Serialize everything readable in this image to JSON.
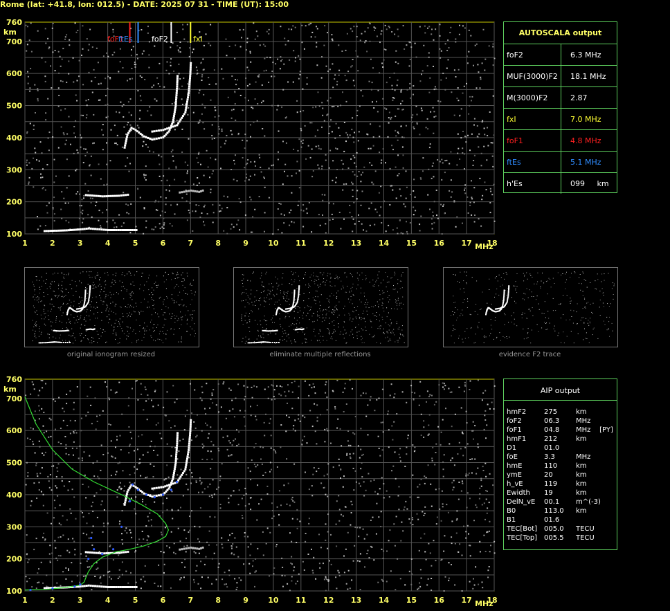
{
  "header": {
    "title": "Rome (lat: +41.8, lon: 012.5) - DATE: 2025 07 31 - TIME (UT): 15:00"
  },
  "autoscala": {
    "title": "AUTOSCALA output",
    "rows": [
      {
        "label": "foF2",
        "value": "6.3 MHz",
        "color": "#ffffff"
      },
      {
        "label": "MUF(3000)F2",
        "value": "18.1 MHz",
        "color": "#ffffff"
      },
      {
        "label": "M(3000)F2",
        "value": "2.87",
        "color": "#ffffff"
      },
      {
        "label": "fxI",
        "value": "7.0 MHz",
        "color": "#ffff33"
      },
      {
        "label": "foF1",
        "value": "4.8 MHz",
        "color": "#ff2020"
      },
      {
        "label": "ftEs",
        "value": "5.1 MHz",
        "color": "#2f8cff"
      },
      {
        "label": "h'Es",
        "value": "099     km",
        "color": "#ffffff"
      }
    ]
  },
  "aip": {
    "title": "AIP output",
    "rows": [
      {
        "name": "hmF2",
        "value": "275",
        "unit": "km"
      },
      {
        "name": "foF2",
        "value": "06.3",
        "unit": "MHz"
      },
      {
        "name": "foF1",
        "value": "04.8",
        "unit": "MHz    [PY]"
      },
      {
        "name": "hmF1",
        "value": "212",
        "unit": "km"
      },
      {
        "name": "D1",
        "value": "01.0",
        "unit": ""
      },
      {
        "name": "foE",
        "value": "3.3",
        "unit": "MHz"
      },
      {
        "name": "hmE",
        "value": "110",
        "unit": "km"
      },
      {
        "name": "ymE",
        "value": "20",
        "unit": "km"
      },
      {
        "name": "h_vE",
        "value": "119",
        "unit": "km"
      },
      {
        "name": "Ewidth",
        "value": "19",
        "unit": "km"
      },
      {
        "name": "DelN_vE",
        "value": "00.1",
        "unit": "m^(-3)"
      },
      {
        "name": "B0",
        "value": "113.0",
        "unit": "km"
      },
      {
        "name": "B1",
        "value": "01.6",
        "unit": ""
      },
      {
        "name": "TEC[Bot]",
        "value": "005.0",
        "unit": "TECU"
      },
      {
        "name": "TEC[Top]",
        "value": "005.5",
        "unit": "TECU"
      }
    ]
  },
  "thumbnails": {
    "captions": [
      "original ionogram resized",
      "eliminate multiple reflections",
      "evidence F2 trace"
    ]
  },
  "chart_data": [
    {
      "type": "scatter",
      "xlabel": "MHz",
      "ylabel": "km",
      "xlim": [
        1,
        18
      ],
      "ylim": [
        100,
        760
      ],
      "x_ticks": [
        1,
        2,
        3,
        4,
        5,
        6,
        7,
        8,
        9,
        10,
        11,
        12,
        13,
        14,
        15,
        16,
        17,
        18
      ],
      "y_ticks": [
        100,
        200,
        300,
        400,
        500,
        600,
        700,
        760
      ],
      "grid": true,
      "markers": [
        {
          "name": "foF1",
          "x": 4.8,
          "color": "#ff2020"
        },
        {
          "name": "ftEs",
          "x": 5.1,
          "color": "#2f8cff"
        },
        {
          "name": "foF2",
          "x": 6.3,
          "color": "#ffffff"
        },
        {
          "name": "fxI",
          "x": 7.0,
          "color": "#ffff33"
        }
      ],
      "marker_label_foF1": "foF1",
      "marker_label_ftEs": "ftEs",
      "marker_label_foF2": "foF2",
      "marker_label_fxI": "fxI",
      "traces": {
        "es_trace": [
          [
            1.7,
            110
          ],
          [
            2.5,
            112
          ],
          [
            3.0,
            115
          ],
          [
            3.3,
            118
          ],
          [
            4.0,
            113
          ],
          [
            5.1,
            113
          ]
        ],
        "e_trace": [
          [
            3.2,
            222
          ],
          [
            3.8,
            218
          ],
          [
            4.4,
            220
          ],
          [
            4.8,
            224
          ]
        ],
        "f1_o_trace": [
          [
            4.6,
            370
          ],
          [
            4.7,
            410
          ],
          [
            4.85,
            432
          ],
          [
            5.0,
            425
          ],
          [
            5.3,
            405
          ],
          [
            5.6,
            395
          ],
          [
            6.0,
            402
          ],
          [
            6.2,
            420
          ],
          [
            6.35,
            450
          ],
          [
            6.45,
            500
          ],
          [
            6.5,
            560
          ],
          [
            6.52,
            600
          ]
        ],
        "f2_x_trace": [
          [
            5.6,
            420
          ],
          [
            6.0,
            425
          ],
          [
            6.5,
            440
          ],
          [
            6.8,
            480
          ],
          [
            6.92,
            540
          ],
          [
            6.98,
            600
          ],
          [
            7.0,
            640
          ]
        ],
        "weak_trace": [
          [
            6.6,
            230
          ],
          [
            7.0,
            236
          ],
          [
            7.3,
            232
          ],
          [
            7.5,
            238
          ]
        ]
      }
    },
    {
      "type": "scatter",
      "xlabel": "MHz",
      "ylabel": "km",
      "xlim": [
        1,
        18
      ],
      "ylim": [
        100,
        760
      ],
      "x_ticks": [
        1,
        2,
        3,
        4,
        5,
        6,
        7,
        8,
        9,
        10,
        11,
        12,
        13,
        14,
        15,
        16,
        17,
        18
      ],
      "y_ticks": [
        100,
        200,
        300,
        400,
        500,
        600,
        700,
        760
      ],
      "grid": true,
      "profile_green": [
        [
          1.0,
          705
        ],
        [
          1.4,
          620
        ],
        [
          2.0,
          540
        ],
        [
          2.7,
          480
        ],
        [
          3.5,
          440
        ],
        [
          4.5,
          400
        ],
        [
          5.2,
          370
        ],
        [
          5.8,
          340
        ],
        [
          6.1,
          310
        ],
        [
          6.2,
          290
        ],
        [
          6.1,
          270
        ],
        [
          5.8,
          255
        ],
        [
          5.3,
          240
        ],
        [
          4.8,
          230
        ],
        [
          4.3,
          222
        ],
        [
          3.8,
          205
        ],
        [
          3.5,
          185
        ],
        [
          3.3,
          160
        ],
        [
          3.2,
          140
        ],
        [
          3.15,
          128
        ],
        [
          3.0,
          118
        ],
        [
          2.5,
          111
        ],
        [
          1.8,
          105
        ],
        [
          1.0,
          103
        ]
      ],
      "blue_points": [
        [
          1.2,
          103
        ],
        [
          2.0,
          108
        ],
        [
          2.8,
          114
        ],
        [
          3.0,
          120
        ],
        [
          3.3,
          200
        ],
        [
          3.4,
          265
        ],
        [
          3.5,
          230
        ],
        [
          3.8,
          215
        ],
        [
          4.2,
          230
        ],
        [
          4.5,
          300
        ],
        [
          4.8,
          380
        ],
        [
          4.9,
          432
        ],
        [
          5.1,
          415
        ],
        [
          5.4,
          400
        ],
        [
          5.7,
          392
        ],
        [
          6.0,
          400
        ],
        [
          6.3,
          415
        ],
        [
          6.5,
          440
        ]
      ]
    }
  ]
}
